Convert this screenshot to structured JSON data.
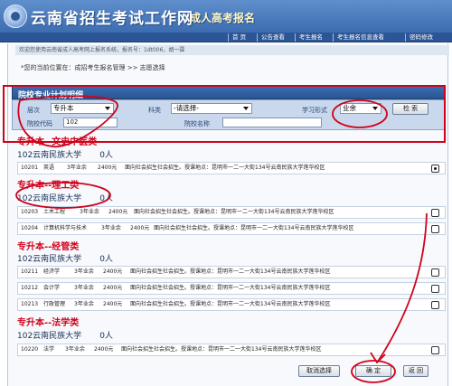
{
  "header": {
    "site_title": "云南省招生考试工作网",
    "sub_title": "成人高考报名"
  },
  "nav": {
    "items": [
      "首 页",
      "公告查看",
      "考生报名",
      "考生报名信息查看",
      "密码修改"
    ]
  },
  "notice": "欢迎您使用云南省成人高考网上报名系统，报名号：1dt006，胡一霖",
  "breadcrumb": "*您的当前位置在：成招考生报名管理 >> 志愿选择",
  "panel": {
    "title": "院校专业计划明细"
  },
  "filters": {
    "level_label": "层次",
    "level_value": "专升本",
    "subject_label": "科类",
    "subject_value": "-请选择-",
    "study_label": "学习形式",
    "study_value": "业余",
    "school_code_label": "院校代码",
    "school_code_value": "102",
    "school_name_label": "院校名称",
    "school_name_value": "",
    "search_label": "检 索"
  },
  "groups": [
    {
      "heading": "专升本--文史中医类",
      "school": "102云南民族大学",
      "count": "0人",
      "majors": [
        {
          "code": "10201",
          "name": "英语",
          "years": "3年业余",
          "fee": "2400元",
          "note": "面向社会招生社会招生。授课地点：昆明市一二一大街134号云南民族大学莲华校区",
          "checked": true
        }
      ]
    },
    {
      "heading": "专升本--理工类",
      "school": "102云南民族大学",
      "count": "0人",
      "majors": [
        {
          "code": "10203",
          "name": "土木工程",
          "years": "3年业余",
          "fee": "2400元",
          "note": "面向社会招生社会招生。授课地点：昆明市一二一大街134号云南民族大学莲华校区",
          "checked": false
        },
        {
          "code": "10204",
          "name": "计算机科学与技术",
          "years": "3年业余",
          "fee": "2400元",
          "note": "面向社会招生社会招生。授课地点：昆明市一二一大街134号云南民族大学莲华校区",
          "checked": false
        }
      ]
    },
    {
      "heading": "专升本--经管类",
      "school": "102云南民族大学",
      "count": "0人",
      "majors": [
        {
          "code": "10211",
          "name": "经济学",
          "years": "3年业余",
          "fee": "2400元",
          "note": "面向社会招生社会招生。授课地点：昆明市一二一大街134号云南民族大学莲华校区",
          "checked": false
        },
        {
          "code": "10212",
          "name": "会计学",
          "years": "3年业余",
          "fee": "2400元",
          "note": "面向社会招生社会招生。授课地点：昆明市一二一大街134号云南民族大学莲华校区",
          "checked": false
        },
        {
          "code": "10213",
          "name": "行政管理",
          "years": "3年业余",
          "fee": "2400元",
          "note": "面向社会招生社会招生。授课地点：昆明市一二一大街134号云南民族大学莲华校区",
          "checked": false
        }
      ]
    },
    {
      "heading": "专升本--法学类",
      "school": "102云南民族大学",
      "count": "0人",
      "majors": [
        {
          "code": "10220",
          "name": "法学",
          "years": "3年业余",
          "fee": "2400元",
          "note": "面向社会招生社会招生。授课地点：昆明市一二一大街134号云南民族大学莲华校区",
          "checked": false
        }
      ]
    }
  ],
  "buttons": {
    "cancel": "取消选择",
    "confirm": "确 定",
    "back": "返 回"
  },
  "colors": {
    "annotation": "#d0021b",
    "heading": "#d0021b",
    "brand": "#3d6cb0"
  }
}
